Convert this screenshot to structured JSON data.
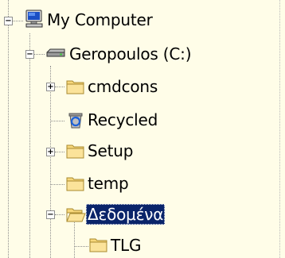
{
  "tree": {
    "root": {
      "label": "My Computer",
      "icon": "computer-icon",
      "expanded": true
    },
    "drive": {
      "label": "Geropoulos (C:)",
      "icon": "drive-icon",
      "expanded": true
    },
    "children": [
      {
        "label": "cmdcons",
        "icon": "folder-icon",
        "expander": "+"
      },
      {
        "label": "Recycled",
        "icon": "recycle-bin-icon",
        "expander": ""
      },
      {
        "label": "Setup",
        "icon": "folder-icon",
        "expander": "+"
      },
      {
        "label": "temp",
        "icon": "folder-icon",
        "expander": ""
      },
      {
        "label": "Δεδομένα",
        "icon": "open-folder-icon",
        "expander": "−",
        "selected": true
      }
    ],
    "grandchild": {
      "label": "TLG",
      "icon": "folder-icon"
    }
  },
  "colors": {
    "background": "#fffde8",
    "selection": "#0a246a",
    "folder": "#f7d77a"
  }
}
